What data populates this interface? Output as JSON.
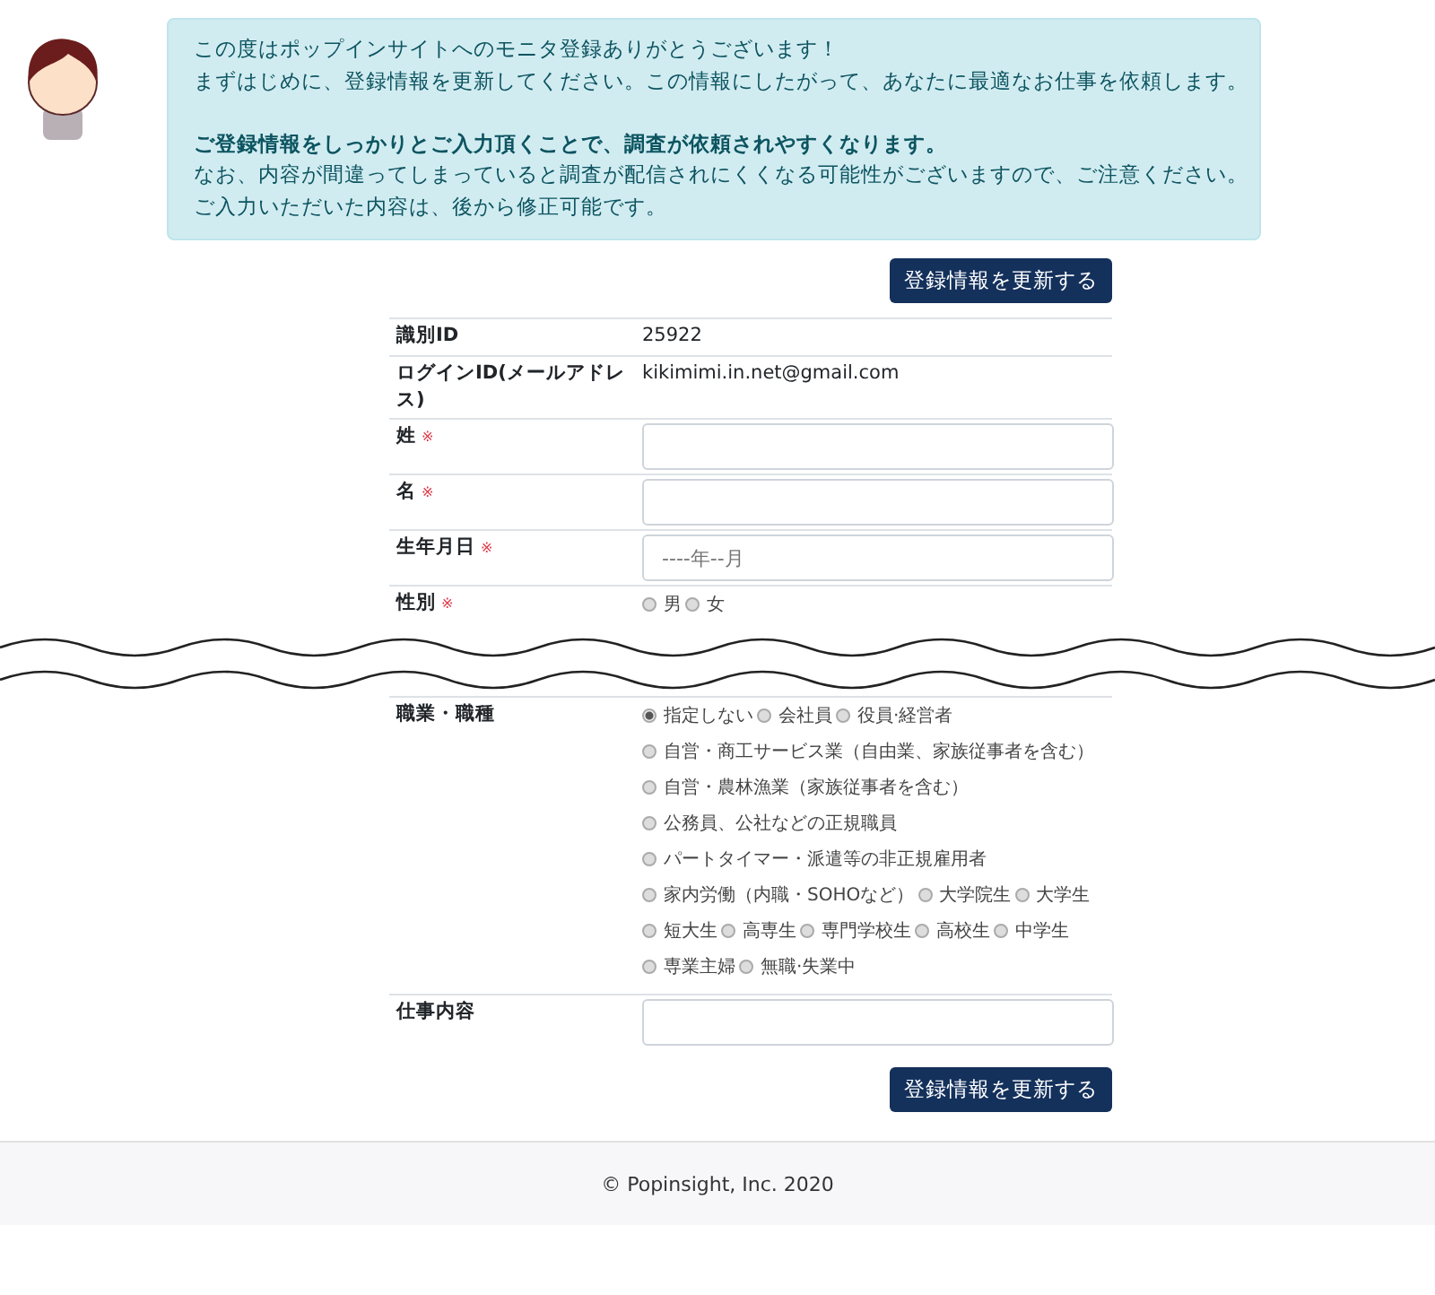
{
  "notice": {
    "lines": [
      {
        "kind": "plain",
        "text": "この度はポップインサイトへのモニタ登録ありがとうございます！"
      },
      {
        "kind": "plain",
        "text": "まずはじめに、登録情報を更新してください。この情報にしたがって、あなたに最適なお仕事を依頼します。"
      },
      {
        "kind": "gap"
      },
      {
        "kind": "bold",
        "text": "ご登録情報をしっかりとご入力頂くことで、調査が依頼されやすくなります。"
      },
      {
        "kind": "plain",
        "text": "なお、内容が間違ってしまっていると調査が配信されにくくなる可能性がございますので、ご注意ください。"
      },
      {
        "kind": "plain",
        "text": "ご入力いただいた内容は、後から修正可能です。"
      }
    ]
  },
  "top_button": "登録情報を更新する",
  "form_top": [
    {
      "kind": "static",
      "label": "識別ID",
      "value": "25922"
    },
    {
      "kind": "static",
      "label": "ログインID(メールアドレス)",
      "value": "kikimimi.in.net@gmail.com"
    },
    {
      "kind": "input",
      "label": "姓",
      "required_mark": "※"
    },
    {
      "kind": "input",
      "label": "名",
      "required_mark": "※"
    },
    {
      "kind": "input",
      "label": "生年月日",
      "required_mark": "※",
      "placeholder": "----年--月"
    },
    {
      "kind": "radios",
      "label": "性別",
      "required_mark": "※",
      "lines": [
        [
          {
            "label": "男",
            "selected": false
          },
          {
            "label": "女",
            "selected": false
          }
        ]
      ]
    }
  ],
  "form_bottom": [
    {
      "kind": "radios",
      "label": "職業・職種",
      "lines": [
        [
          {
            "label": "指定しない",
            "selected": true
          },
          {
            "label": "会社員",
            "selected": false
          },
          {
            "label": "役員·経営者",
            "selected": false
          }
        ],
        [
          {
            "label": "自営・商工サービス業（自由業、家族従事者を含む）",
            "selected": false
          }
        ],
        [
          {
            "label": "自営・農林漁業（家族従事者を含む）",
            "selected": false
          }
        ],
        [
          {
            "label": "公務員、公社などの正規職員",
            "selected": false
          }
        ],
        [
          {
            "label": "パートタイマー・派遣等の非正規雇用者",
            "selected": false
          }
        ],
        [
          {
            "label": "家内労働（内職・SOHOなど）",
            "selected": false
          },
          {
            "label": "大学院生",
            "selected": false
          },
          {
            "label": "大学生",
            "selected": false
          }
        ],
        [
          {
            "label": "短大生",
            "selected": false
          },
          {
            "label": "高専生",
            "selected": false
          },
          {
            "label": "専門学校生",
            "selected": false
          },
          {
            "label": "高校生",
            "selected": false
          },
          {
            "label": "中学生",
            "selected": false
          }
        ],
        [
          {
            "label": "専業主婦",
            "selected": false
          },
          {
            "label": "無職·失業中",
            "selected": false
          }
        ]
      ]
    },
    {
      "kind": "input",
      "label": "仕事内容"
    }
  ],
  "bottom_button": "登録情報を更新する",
  "footer": "© Popinsight, Inc. 2020"
}
